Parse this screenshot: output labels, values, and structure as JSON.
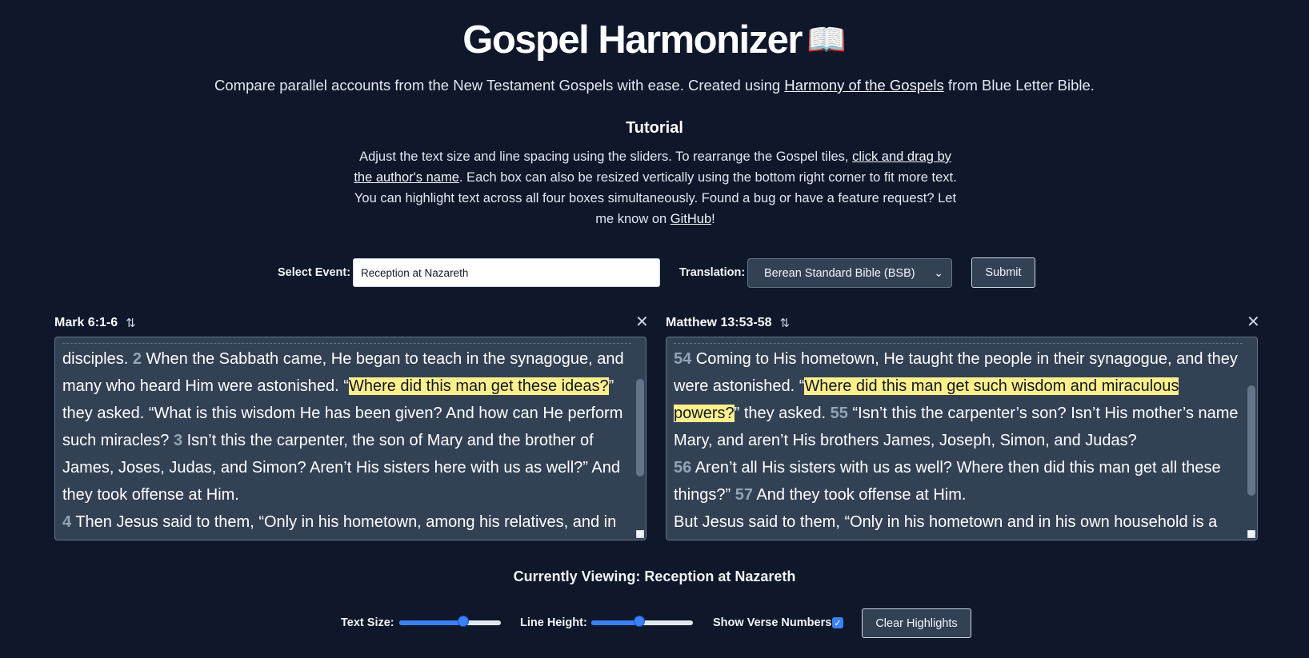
{
  "header": {
    "title": "Gospel Harmonizer",
    "title_icon": "📖",
    "subtitle_prefix": "Compare parallel accounts from the New Testament Gospels with ease. Created using ",
    "subtitle_link": "Harmony of the Gospels",
    "subtitle_suffix": " from Blue Letter Bible."
  },
  "tutorial": {
    "heading": "Tutorial",
    "text_1": "Adjust the text size and line spacing using the sliders. To rearrange the Gospel tiles, ",
    "link_drag": "click and drag by the author's name",
    "text_2": ". Each box can also be resized vertically using the bottom right corner to fit more text. You can highlight text across all four boxes simultaneously. Found a bug or have a feature request? Let me know on ",
    "link_github": "GitHub",
    "text_3": "!"
  },
  "controls": {
    "event_label": "Select Event:",
    "event_value": "Reception at Nazareth",
    "translation_label": "Translation:",
    "translation_value": "Berean Standard Bible (BSB)",
    "submit_label": "Submit"
  },
  "panels": [
    {
      "reference": "Mark 6:1-6",
      "segments": [
        {
          "t": "disciples. "
        },
        {
          "v": "2"
        },
        {
          "t": " When the Sabbath came, He began to teach in the synagogue, and many who heard Him were astonished. “"
        },
        {
          "h": "Where did this man get these ideas?"
        },
        {
          "t": "” they asked. “What is this wisdom He has been given? And how can He perform such miracles? "
        },
        {
          "v": "3"
        },
        {
          "t": " Isn’t this the carpenter, the son of Mary and the brother of James, Joses, Judas, and Simon? Aren’t His sisters here with us as well?” And they took offense at Him."
        },
        {
          "br": true
        },
        {
          "v": "4"
        },
        {
          "t": " Then Jesus said to them, “Only in his hometown, among his relatives, and in"
        }
      ]
    },
    {
      "reference": "Matthew 13:53-58",
      "segments": [
        {
          "v": "54"
        },
        {
          "t": " Coming to His hometown, He taught the people in their synagogue, and they were astonished. “"
        },
        {
          "h": "Where did this man get such wisdom and miraculous powers?"
        },
        {
          "t": "” they asked. "
        },
        {
          "v": "55"
        },
        {
          "t": " “Isn’t this the carpenter’s son? Isn’t His mother’s name Mary, and aren’t His brothers James, Joseph, Simon, and Judas?"
        },
        {
          "br": true
        },
        {
          "v": "56"
        },
        {
          "t": " Aren’t all His sisters with us as well? Where then did this man get all these things?” "
        },
        {
          "v": "57"
        },
        {
          "t": " And they took offense at Him."
        },
        {
          "br": true
        },
        {
          "t": "But Jesus said to them, “Only in his hometown and in his own household is a"
        }
      ]
    }
  ],
  "viewing": {
    "prefix": "Currently Viewing: ",
    "event": "Reception at Nazareth"
  },
  "footer": {
    "text_size_label": "Text Size:",
    "text_size_value": 0.65,
    "line_height_label": "Line Height:",
    "line_height_value": 0.47,
    "verse_numbers_label": "Show Verse Numbers",
    "verse_numbers_checked": true,
    "clear_label": "Clear Highlights"
  },
  "colors": {
    "background": "#0f172a",
    "panel": "#334155",
    "highlight": "#fef08a",
    "accent": "#3b82f6"
  },
  "icons": {
    "swap": "swap-vertical-icon",
    "close": "close-icon",
    "dropdown": "chevron-down-icon",
    "check": "checkmark-icon",
    "resize": "resize-grip-icon"
  }
}
